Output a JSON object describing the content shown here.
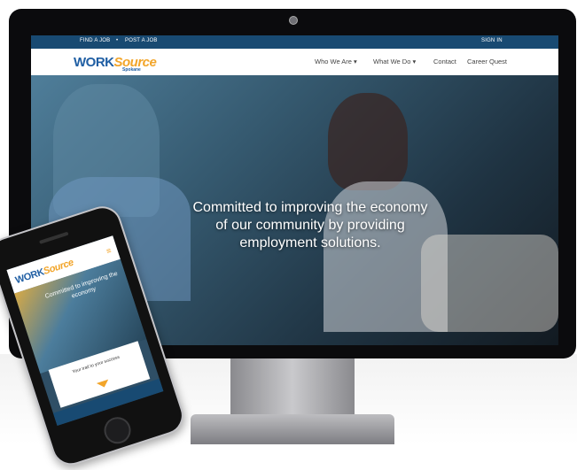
{
  "desktop_site": {
    "utility_bar": {
      "find_job": "FIND A JOB",
      "dot": "•",
      "post_job": "POST A JOB",
      "sign_in": "SIGN IN"
    },
    "logo": {
      "work": "WORK",
      "source": "Source",
      "sub": "Spokane"
    },
    "nav": {
      "who_we_are": "Who We Are ▾",
      "what_we_do": "What We Do ▾",
      "contact": "Contact",
      "career_quest": "Career Quest"
    },
    "hero": {
      "line1": "Committed to improving the economy",
      "line2": "of our community by providing",
      "line3": "employment solutions."
    }
  },
  "mobile_site": {
    "logo": {
      "work": "WORK",
      "source": "Source"
    },
    "menu": "≡",
    "hero_text": "Committed to improving the economy",
    "card_text": "Your trail to your success"
  },
  "colors": {
    "brand_blue": "#184a72",
    "logo_blue": "#1f5ea3",
    "logo_orange": "#f2a52a"
  }
}
